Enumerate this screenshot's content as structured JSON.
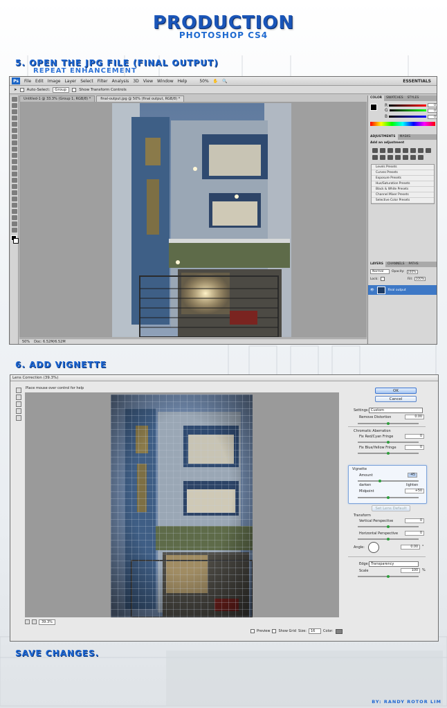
{
  "page": {
    "title": "PRODUCTION",
    "subtitle": "PHOTOSHOP CS4",
    "step5": {
      "heading": "5. OPEN THE JPG FILE (FINAL OUTPUT)",
      "sub": "REPEAT ENHANCEMENT"
    },
    "step6": {
      "heading": "6. ADD VIGNETTE"
    },
    "save": "SAVE CHANGES.",
    "credit": "BY: RANDY ROTOR LIM"
  },
  "photoshop": {
    "menu": [
      "File",
      "Edit",
      "Image",
      "Layer",
      "Select",
      "Filter",
      "Analysis",
      "3D",
      "View",
      "Window",
      "Help"
    ],
    "zoom": "50%",
    "workspace": "ESSENTIALS",
    "options": {
      "auto_select": "Auto-Select:",
      "auto_select_value": "Group",
      "transform": "Show Transform Controls"
    },
    "tabs": [
      "Untitled-1 @ 33.3% (Group 1, RGB/8) *",
      "final-output.jpg @ 50% (final output, RGB/8) *"
    ],
    "status": {
      "zoom": "50%",
      "doc": "Doc: 6.52M/6.52M"
    },
    "panels": {
      "color_tabs": [
        "COLOR",
        "SWATCHES",
        "STYLES"
      ],
      "color_values": {
        "r": "0",
        "g": "0",
        "b": "0"
      },
      "adjust_tabs": [
        "ADJUSTMENTS",
        "MASKS"
      ],
      "adjust_title": "Add an adjustment",
      "presets": [
        "Levels Presets",
        "Curves Presets",
        "Exposure Presets",
        "Hue/Saturation Presets",
        "Black & White Presets",
        "Channel Mixer Presets",
        "Selective Color Presets"
      ],
      "layer_tabs": [
        "LAYERS",
        "CHANNELS",
        "PATHS"
      ],
      "blend_mode": "Normal",
      "opacity_label": "Opacity:",
      "opacity": "100%",
      "lock_label": "Lock:",
      "fill_label": "Fill:",
      "fill": "100%",
      "layer_name": "final output"
    }
  },
  "lens": {
    "title": "Lens Correction (39.3%)",
    "help": "Place mouse over control for help",
    "ok": "OK",
    "cancel": "Cancel",
    "settings_label": "Settings:",
    "settings_value": "Custom",
    "remove_distortion": "Remove Distortion",
    "remove_distortion_val": "0.00",
    "chromatic": "Chromatic Aberration",
    "fix_red": "Fix Red/Cyan Fringe",
    "fix_red_val": "0",
    "fix_blue": "Fix Blue/Yellow Fringe",
    "fix_blue_val": "0",
    "vignette": "Vignette",
    "amount": "Amount",
    "amount_val": "-45",
    "darken": "darken",
    "lighten": "lighten",
    "midpoint": "Midpoint",
    "midpoint_val": "+50",
    "set_default": "Set Lens Default",
    "transform": "Transform",
    "vertical": "Vertical Perspective",
    "vertical_val": "0",
    "horizontal": "Horizontal Perspective",
    "horizontal_val": "0",
    "angle": "Angle:",
    "angle_val": "0.00",
    "angle_unit": "°",
    "edge": "Edge:",
    "edge_value": "Transparency",
    "scale": "Scale",
    "scale_val": "100",
    "scale_unit": "%",
    "zoom": "39.3%",
    "preview": "Preview",
    "show_grid": "Show Grid",
    "size_label": "Size:",
    "size_val": "16",
    "color_label": "Color:"
  }
}
